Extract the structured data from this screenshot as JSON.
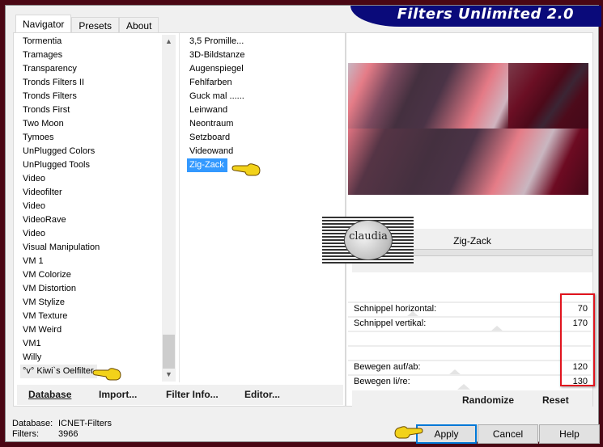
{
  "window": {
    "title": "Filters Unlimited 2.0",
    "frame_color": "#4a0714",
    "banner_color": "#0a0a7a"
  },
  "tabs": [
    {
      "label": "Navigator",
      "active": true
    },
    {
      "label": "Presets",
      "active": false
    },
    {
      "label": "About",
      "active": false
    }
  ],
  "categories": {
    "items": [
      "Tormentia",
      "Tramages",
      "Transparency",
      "Tronds Filters II",
      "Tronds Filters",
      "Tronds First",
      "Two Moon",
      "Tymoes",
      "UnPlugged Colors",
      "UnPlugged Tools",
      "Video",
      "Videofilter",
      "Video",
      "VideoRave",
      "Video",
      "Visual Manipulation",
      "VM 1",
      "VM Colorize",
      "VM Distortion",
      "VM Stylize",
      "VM Texture",
      "VM Weird",
      "VM1",
      "Willy",
      "°v° Kiwi`s Oelfilter"
    ],
    "selected": "°v° Kiwi`s Oelfilter",
    "scroll_up_icon": "chevron-up-icon",
    "scroll_down_icon": "chevron-down-icon"
  },
  "filters": {
    "items": [
      "3,5 Promille...",
      "3D-Bildstanze",
      "Augenspiegel",
      "Fehlfarben",
      "Guck mal ......",
      "Leinwand",
      "Neontraum",
      "Setzboard",
      "Videowand",
      "Zig-Zack"
    ],
    "selected": "Zig-Zack"
  },
  "toolbar": {
    "database": "Database",
    "import": "Import...",
    "filter_info": "Filter Info...",
    "editor": "Editor..."
  },
  "status": {
    "database_label": "Database:",
    "database_value": "ICNET-Filters",
    "filters_label": "Filters:",
    "filters_value": "3966"
  },
  "preview": {
    "filter_name": "Zig-Zack",
    "watermark": "claudia"
  },
  "parameters": [
    {
      "label": "Schnippel horizontal:",
      "value": "70",
      "fraction": 0.27
    },
    {
      "label": "Schnippel vertikal:",
      "value": "170",
      "fraction": 0.67
    },
    {
      "label": "",
      "value": "",
      "fraction": null
    },
    {
      "label": "",
      "value": "",
      "fraction": null
    },
    {
      "label": "Bewegen auf/ab:",
      "value": "120",
      "fraction": 0.47
    },
    {
      "label": "Bewegen li/re:",
      "value": "130",
      "fraction": 0.51
    }
  ],
  "param_buttons": {
    "randomize": "Randomize",
    "reset": "Reset"
  },
  "dialog_buttons": {
    "apply": "Apply",
    "cancel": "Cancel",
    "help": "Help"
  },
  "annotations": {
    "highlight_color": "#e0141e",
    "pointer_icon": "pointing-hand-icon"
  }
}
